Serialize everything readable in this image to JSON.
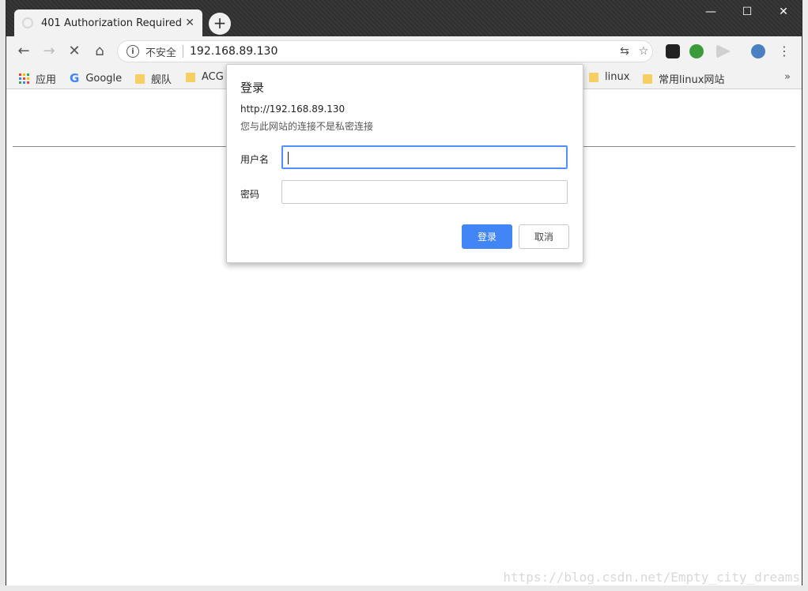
{
  "browser": {
    "tab_title": "401 Authorization Required",
    "tab_close": "✕",
    "new_tab": "+",
    "window_controls": {
      "minimize": "—",
      "maximize": "☐",
      "close": "✕"
    },
    "nav": {
      "back": "←",
      "forward": "→",
      "stop": "✕",
      "home": "⌂"
    },
    "security_label": "不安全",
    "url": "192.168.89.130",
    "omnibox_icons": [
      "translate-icon",
      "star-icon"
    ],
    "menu": "⋮"
  },
  "bookmarks": {
    "items": [
      {
        "label": "应用",
        "icon": "apps-grid-icon"
      },
      {
        "label": "Google",
        "icon": "google-icon"
      },
      {
        "label": "舰队",
        "icon": "folder-icon"
      },
      {
        "label": "ACG",
        "icon": "folder-icon"
      },
      {
        "label": "linux",
        "icon": "folder-icon"
      },
      {
        "label": "常用linux网站",
        "icon": "folder-icon"
      }
    ],
    "more": "»"
  },
  "dialog": {
    "title": "登录",
    "host": "http://192.168.89.130",
    "warning": "您与此网站的连接不是私密连接",
    "username_label": "用户名",
    "username_value": "",
    "password_label": "密码",
    "password_value": "",
    "login_button": "登录",
    "cancel_button": "取消"
  },
  "watermark": "https://blog.csdn.net/Empty_city_dreams",
  "colors": {
    "accent": "#4285f4",
    "folder": "#f5cf62",
    "focus_border": "#4d90fe"
  }
}
